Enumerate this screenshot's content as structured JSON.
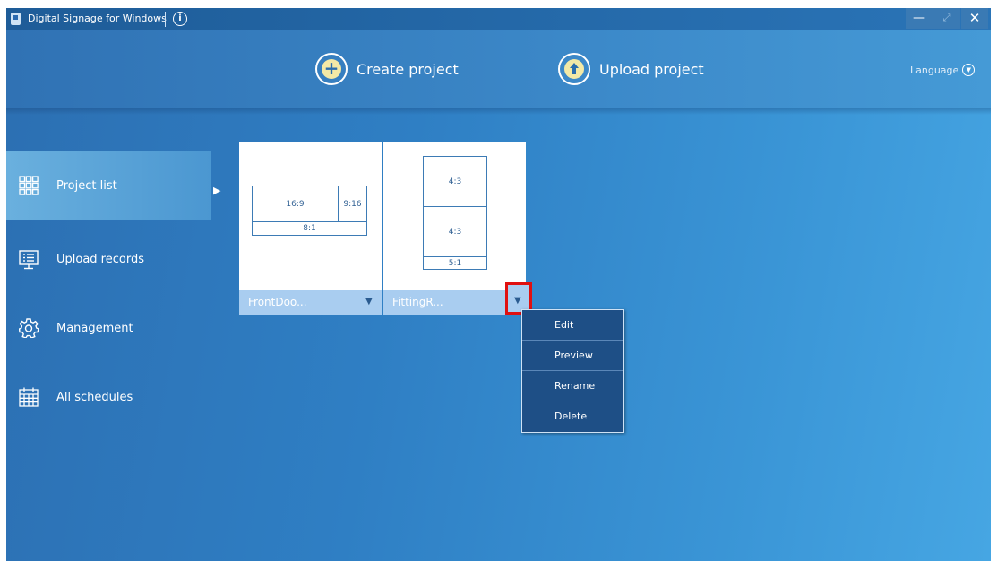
{
  "window": {
    "title": "Digital Signage for Windows",
    "controls": [
      "minimize",
      "maximize",
      "close"
    ]
  },
  "header": {
    "create_label": "Create project",
    "upload_label": "Upload project",
    "language_label": "Language"
  },
  "sidebar": {
    "items": [
      {
        "label": "Project list",
        "icon": "grid-icon",
        "active": true
      },
      {
        "label": "Upload records",
        "icon": "monitor-list-icon",
        "active": false
      },
      {
        "label": "Management",
        "icon": "gear-icon",
        "active": false
      },
      {
        "label": "All schedules",
        "icon": "calendar-icon",
        "active": false
      }
    ]
  },
  "projects": [
    {
      "name": "FrontDoo...",
      "cells": [
        "16:9",
        "9:16",
        "8:1"
      ]
    },
    {
      "name": "FittingR...",
      "cells": [
        "4:3",
        "4:3",
        "5:1"
      ]
    }
  ],
  "context_menu": {
    "items": [
      "Edit",
      "Preview",
      "Rename",
      "Delete"
    ]
  },
  "colors": {
    "accent": "#2f7fc4",
    "menu_bg": "#1e4f86",
    "card_footer": "#a9cdf0",
    "highlight": "#e01010"
  }
}
